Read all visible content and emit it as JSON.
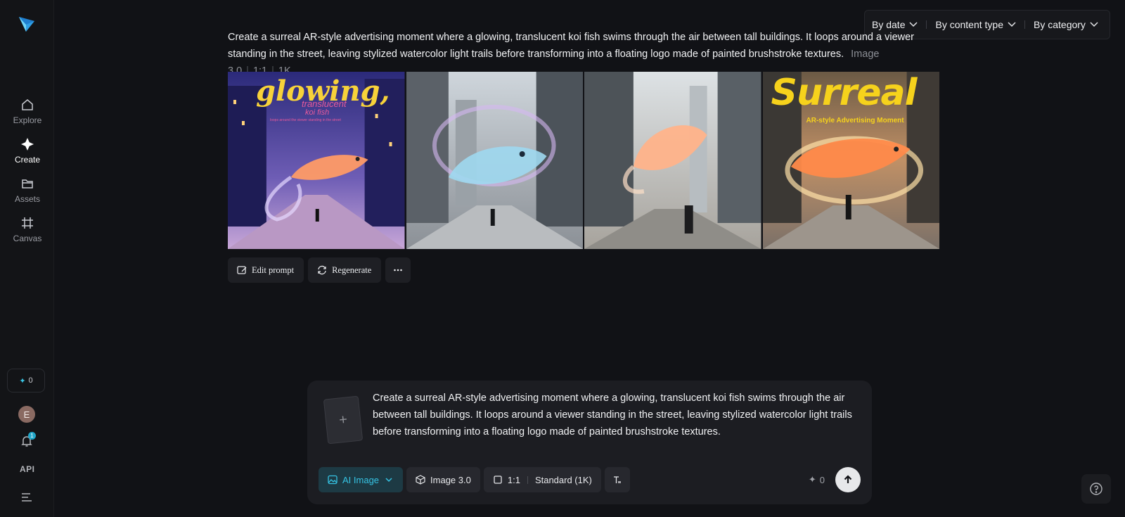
{
  "sidebar": {
    "items": [
      {
        "label": "Explore",
        "icon": "home-icon"
      },
      {
        "label": "Create",
        "icon": "diamond-sparkle-icon"
      },
      {
        "label": "Assets",
        "icon": "folder-icon"
      },
      {
        "label": "Canvas",
        "icon": "frame-grid-icon"
      }
    ],
    "credits": "0",
    "avatar_initial": "E",
    "notification_count": "1",
    "api_label": "API"
  },
  "filters": {
    "by_date": "By date",
    "by_content_type": "By content type",
    "by_category": "By category"
  },
  "generation": {
    "prompt": "Create a surreal AR-style advertising moment where a glowing, translucent koi fish swims through the air between tall buildings. It loops around a viewer standing in the street, leaving stylized watercolor light trails before transforming into a floating logo made of painted brushstroke textures.",
    "model": "Image 3.0",
    "ratio": "1:1",
    "resolution": "1K",
    "image_texts": {
      "img1_title": "glowing,",
      "img1_subtitle": "translucent",
      "img1_sub2": "koi fish",
      "img1_tagline": "loops around the viewer standing in the street",
      "img4_title": "Surreal",
      "img4_subtitle": "AR-style Advertising Moment"
    }
  },
  "actions": {
    "edit_prompt": "Edit prompt",
    "regenerate": "Regenerate"
  },
  "composer": {
    "text": "Create a surreal AR-style advertising moment where a glowing, translucent koi fish swims through the air between tall buildings. It loops around a viewer standing in the street, leaving stylized watercolor light trails before transforming into a floating logo made of painted brushstroke textures.",
    "mode": "AI Image",
    "model": "Image 3.0",
    "ratio": "1:1",
    "quality": "Standard (1K)",
    "cost": "0"
  },
  "colors": {
    "accent": "#35c3e3",
    "background": "#111216",
    "panel": "#1c1d22"
  }
}
